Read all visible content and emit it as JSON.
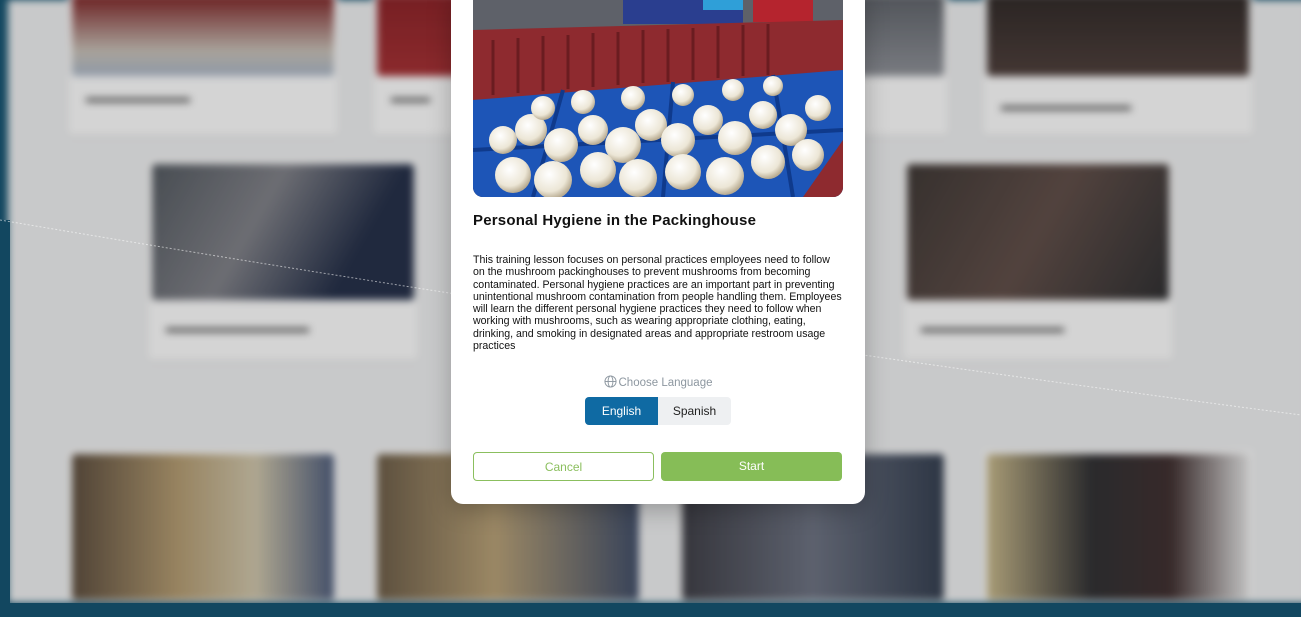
{
  "background": {
    "section_heading": "",
    "cards_row1": [
      "",
      "",
      "",
      ""
    ],
    "cards_row2": [
      "",
      "",
      "",
      ""
    ]
  },
  "modal": {
    "title": "Personal Hygiene in the Packinghouse",
    "description": "This training lesson focuses on personal practices employees need to follow on the mushroom packinghouses to prevent mushrooms from becoming contaminated. Personal hygiene practices are an important part in preventing unintentional mushroom contamination from people handling them. Employees will learn the different personal hygiene practices they need to follow when working with mushrooms, such as wearing appropriate clothing, eating, drinking, and smoking in designated areas and appropriate restroom usage practices",
    "language": {
      "label": "Choose Language",
      "icon": "globe-icon",
      "options": [
        "English",
        "Spanish"
      ],
      "selected": "English"
    },
    "buttons": {
      "cancel": "Cancel",
      "start": "Start"
    }
  },
  "colors": {
    "brand_blue": "#0f6aa3",
    "accent_green": "#86bd57",
    "dark_teal": "#0d4f6e"
  }
}
